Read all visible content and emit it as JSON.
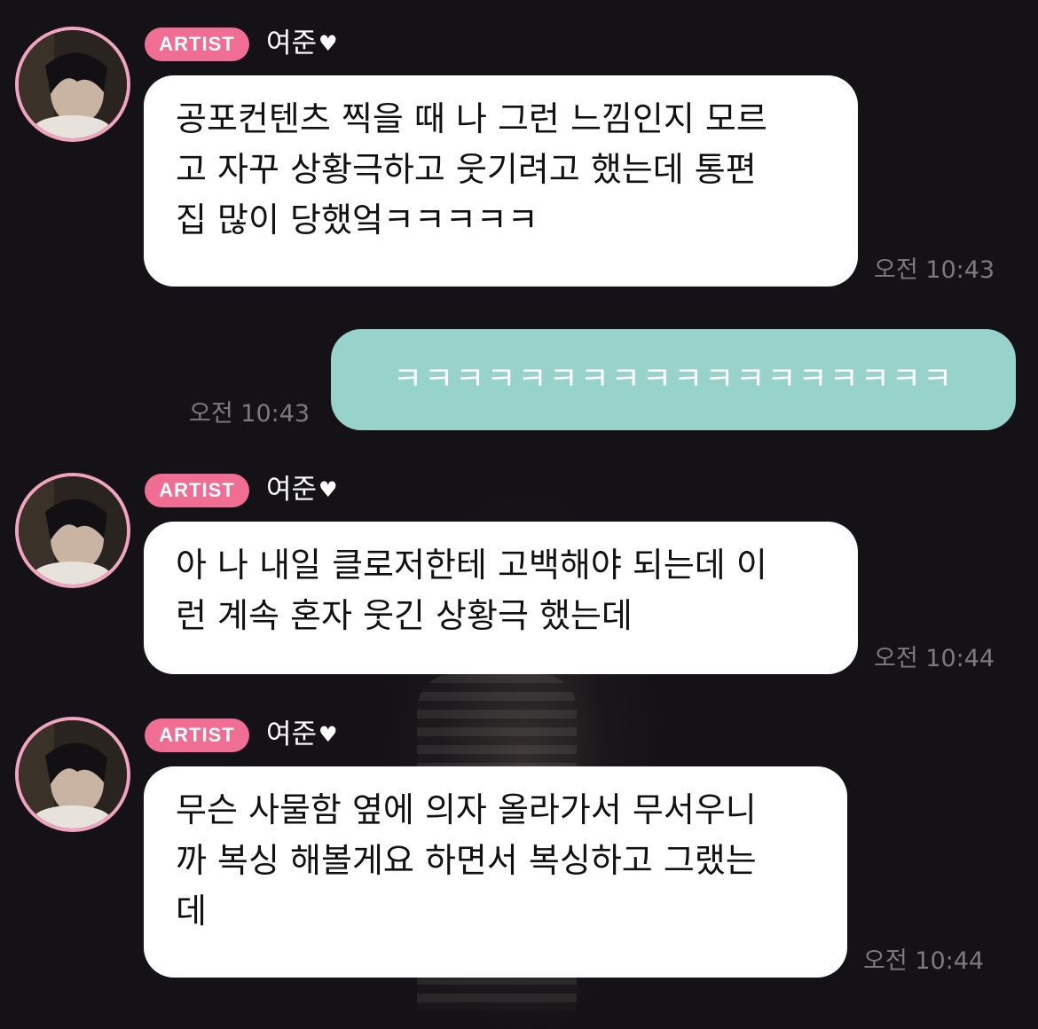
{
  "messages": [
    {
      "sender": "artist",
      "badge": "ARTIST",
      "name": "여준",
      "heart": "♥",
      "text": "공포컨텐츠 찍을 때 나 그런 느낌인지 모르\n고 자꾸 상황극하고 웃기려고 했는데 통편\n집 많이 당했엌ㅋㅋㅋㅋㅋ",
      "time": "오전 10:43"
    },
    {
      "sender": "me",
      "text": "ㅋㅋㅋㅋㅋㅋㅋㅋㅋㅋㅋㅋㅋㅋㅋㅋㅋㅋ",
      "time": "오전 10:43"
    },
    {
      "sender": "artist",
      "badge": "ARTIST",
      "name": "여준",
      "heart": "♥",
      "text": "아 나 내일 클로저한테 고백해야 되는데 이\n런 계속 혼자 웃긴 상황극 했는데",
      "time": "오전 10:44"
    },
    {
      "sender": "artist",
      "badge": "ARTIST",
      "name": "여준",
      "heart": "♥",
      "text": "무슨 사물함 옆에 의자 올라가서 무서우니\n까 복싱 해볼게요 하면서 복싱하고 그랬는\n데",
      "time": "오전 10:44"
    }
  ],
  "colors": {
    "background": "#141216",
    "artist_badge": "#f06e93",
    "avatar_ring": "#f2a4bf",
    "my_bubble": "#97d3cb",
    "artist_bubble": "#ffffff",
    "timestamp": "#7a7a80"
  },
  "icons": [
    "heart-icon",
    "avatar-photo"
  ]
}
